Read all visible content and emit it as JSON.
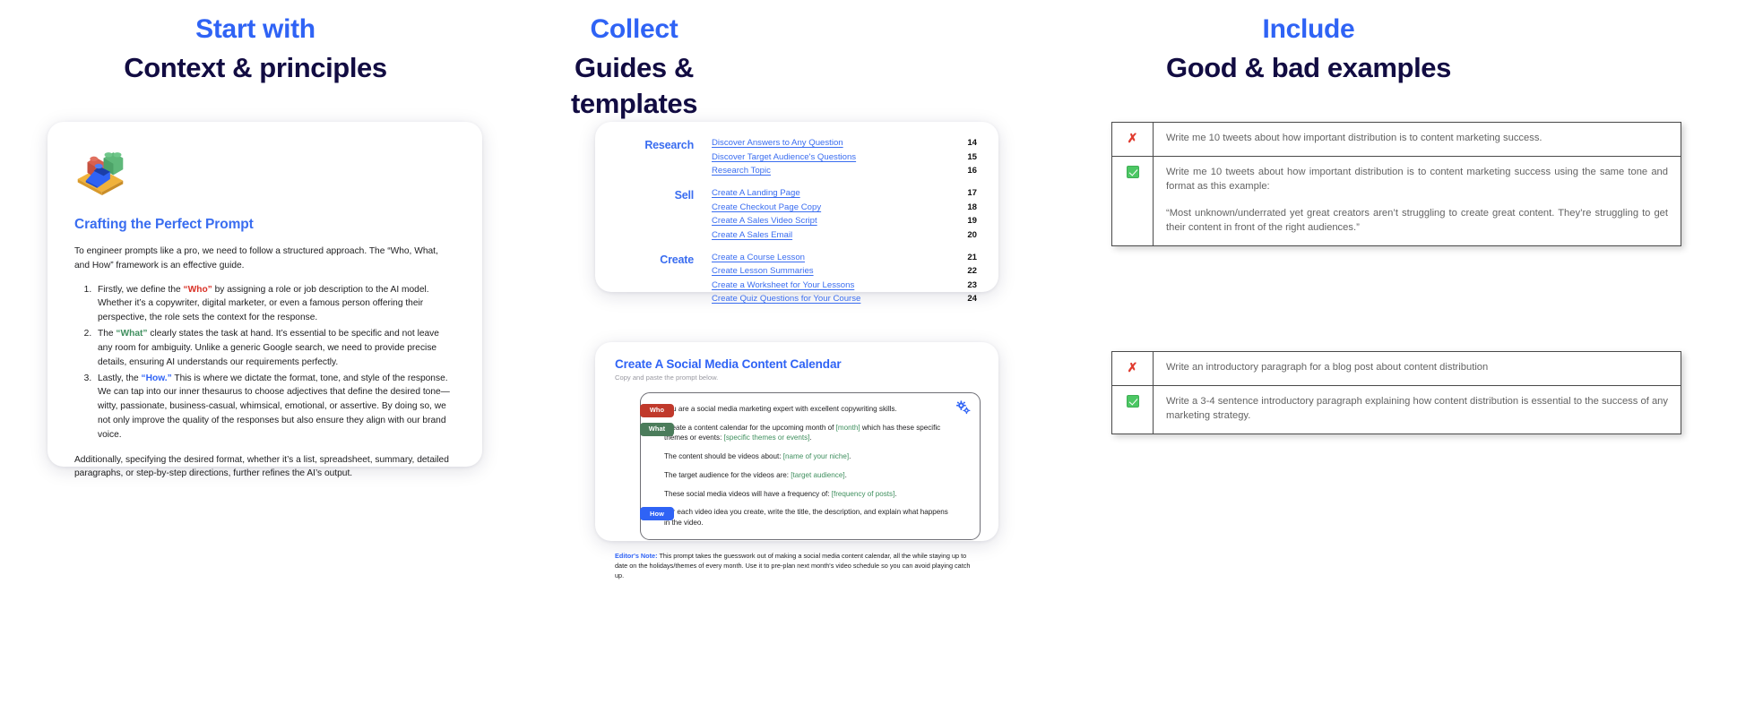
{
  "columns": [
    {
      "eyebrow": "Start with",
      "title": "Context & principles"
    },
    {
      "eyebrow": "Collect",
      "title": "Guides & templates"
    },
    {
      "eyebrow": "Include",
      "title": "Good & bad examples"
    }
  ],
  "prompt_card": {
    "icon": "lego-blocks-icon",
    "heading": "Crafting the Perfect Prompt",
    "intro": "To engineer prompts like a pro, we need to follow a structured approach. The “Who, What, and How” framework is an effective guide.",
    "steps": [
      {
        "lead": "Firstly, we define the",
        "keyword": "“Who”",
        "keyword_color": "#d93025",
        "rest": "by assigning a role or job description to the AI model. Whether it’s a copywriter, digital marketer, or even a famous person offering their perspective, the role sets the context for the response."
      },
      {
        "lead": "The",
        "keyword": "“What”",
        "keyword_color": "#3f8f5e",
        "rest": "clearly states the task at hand. It’s essential to be specific and not leave any room for ambiguity. Unlike a generic Google search, we need to provide precise details, ensuring AI understands our requirements perfectly."
      },
      {
        "lead": "Lastly, the",
        "keyword": "“How.”",
        "keyword_color": "#2f63f5",
        "rest": "This is where we dictate the format, tone, and style of the response. We can tap into our inner thesaurus to choose adjectives that define the desired tone—witty, passionate, business-casual, whimsical, emotional, or assertive. By doing so, we not only improve the quality of the responses but also ensure they align with our brand voice."
      }
    ],
    "outro": "Additionally, specifying the desired format, whether it’s a list, spreadsheet, summary, detailed paragraphs, or step-by-step directions, further refines the AI’s output."
  },
  "toc": {
    "groups": [
      {
        "category": "Research",
        "entries": [
          {
            "title": "Discover Answers to Any Question",
            "page": "14"
          },
          {
            "title": "Discover Target Audience's Questions",
            "page": "15"
          },
          {
            "title": "Research Topic",
            "page": "16"
          }
        ]
      },
      {
        "category": "Sell",
        "entries": [
          {
            "title": "Create A Landing Page",
            "page": "17"
          },
          {
            "title": "Create Checkout Page Copy",
            "page": "18"
          },
          {
            "title": "Create A Sales Video Script",
            "page": "19"
          },
          {
            "title": "Create A Sales Email",
            "page": "20"
          }
        ]
      },
      {
        "category": "Create",
        "entries": [
          {
            "title": "Create a Course Lesson",
            "page": "21"
          },
          {
            "title": "Create Lesson Summaries",
            "page": "22"
          },
          {
            "title": "Create a Worksheet for Your Lessons",
            "page": "23"
          },
          {
            "title": "Create Quiz Questions for Your Course",
            "page": "24"
          }
        ]
      }
    ]
  },
  "calendar_card": {
    "heading": "Create A Social Media Content Calendar",
    "subheading": "Copy and paste the prompt below.",
    "gear_icon": "gears-settings-icon",
    "chips": {
      "who": "Who",
      "what": "What",
      "how": "How"
    },
    "lines": [
      {
        "chip": "who",
        "text": "You are a social media marketing expert with excellent copywriting skills."
      },
      {
        "chip": "what",
        "pre": "Create a content calendar for the upcoming month of ",
        "ph1": "[month]",
        "mid": " which has these specific themes or events: ",
        "ph2": "[specific themes or events]",
        "post": "."
      },
      {
        "chip": null,
        "pre": "The content should be videos about: ",
        "ph1": "[name of your niche]",
        "post": "."
      },
      {
        "chip": null,
        "pre": "The target audience for the videos are: ",
        "ph1": "[target audience]",
        "post": "."
      },
      {
        "chip": null,
        "pre": "These social media videos will have a frequency of: ",
        "ph1": "[frequency of posts]",
        "post": "."
      },
      {
        "chip": "how",
        "text": "For each video idea you create, write the title, the description, and explain what happens in the video."
      }
    ],
    "note_label": "Editor's Note:",
    "note_text": " This prompt takes the guesswork out of making a social media content calendar, all the while staying up to date on the holidays/themes of every month. Use it to pre-plan next month's video schedule so you can avoid playing catch up."
  },
  "examples": {
    "table_1": [
      {
        "mark": "x-mark-icon",
        "status": "bad",
        "paragraphs": [
          "Write me 10 tweets about how important distribution is to content marketing success."
        ]
      },
      {
        "mark": "green-check-icon",
        "status": "good",
        "paragraphs": [
          "Write me 10 tweets about how important distribution is to content marketing success using the same tone and format as this example:",
          "“Most unknown/underrated yet great creators aren’t struggling to create great content. They’re struggling to get their content in front of the right audiences.”"
        ]
      }
    ],
    "table_2": [
      {
        "mark": "x-mark-icon",
        "status": "bad",
        "paragraphs": [
          "Write an introductory paragraph for a blog post about content distribution"
        ]
      },
      {
        "mark": "green-check-icon",
        "status": "good",
        "paragraphs": [
          "Write a 3-4 sentence introductory paragraph explaining how content distribution is essential to the success of any marketing strategy."
        ]
      }
    ]
  },
  "colors": {
    "accent_blue": "#2f63f5",
    "title_navy": "#120c42",
    "link_blue": "#3a6df0",
    "bad_red": "#e03b2f",
    "good_green": "#4cc764"
  }
}
